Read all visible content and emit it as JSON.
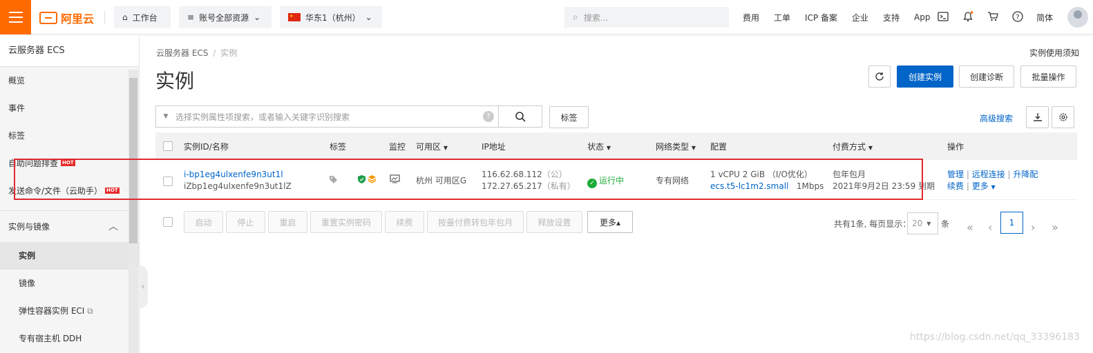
{
  "brand": {
    "name": "阿里云",
    "color": "#ff6a00",
    "primary": "#0064c8"
  },
  "topbar": {
    "workbench": "工作台",
    "resources": "账号全部资源",
    "region": "华东1（杭州）",
    "search_placeholder": "搜索...",
    "links": [
      "费用",
      "工单",
      "ICP 备案",
      "企业",
      "支持",
      "App"
    ],
    "lang": "简体"
  },
  "sidebar": {
    "title": "云服务器 ECS",
    "items": [
      "概览",
      "事件",
      "标签",
      "自助问题排查",
      "发送命令/文件（云助手）"
    ],
    "hot": "HOT",
    "group": "实例与镜像",
    "sub_items": [
      "实例",
      "镜像",
      "弹性容器实例 ECI",
      "专有宿主机 DDH"
    ]
  },
  "main": {
    "breadcrumb": [
      "云服务器 ECS",
      "实例"
    ],
    "help": "实例使用须知",
    "title": "实例",
    "buttons": {
      "create": "创建实例",
      "diagnose": "创建诊断",
      "batch": "批量操作"
    },
    "filter_placeholder": "选择实例属性项搜索，或者输入关键字识别搜索",
    "tag_btn": "标签",
    "advanced": "高级搜索",
    "columns": [
      "实例ID/名称",
      "标签",
      "监控",
      "可用区",
      "IP地址",
      "状态",
      "网络类型",
      "配置",
      "付费方式",
      "操作"
    ],
    "row": {
      "id": "i-bp1eg4ulxenfe9n3ut1l",
      "name": "iZbp1eg4ulxenfe9n3ut1lZ",
      "zone": "杭州 可用区G",
      "ip_public": "116.62.68.112",
      "ip_public_tag": "（公）",
      "ip_private": "172.27.65.217",
      "ip_private_tag": "（私有）",
      "status": "运行中",
      "network": "专有网络",
      "config": "1 vCPU 2 GiB （I/O优化）",
      "spec": "ecs.t5-lc1m2.small",
      "bandwidth": "1Mbps",
      "billing": "包年包月",
      "expire": "2021年9月2日 23:59 到期",
      "ops": [
        "管理",
        "远程连接",
        "升降配",
        "续费",
        "更多"
      ]
    },
    "bulk": [
      "启动",
      "停止",
      "重启",
      "重置实例密码",
      "续费",
      "按量付费转包年包月",
      "释放设置",
      "更多▴"
    ],
    "pagination": {
      "summary": "共有1条, 每页显示：",
      "page_size": "20",
      "unit": "条",
      "current": "1"
    }
  },
  "watermark": "https://blog.csdn.net/qq_33396183"
}
